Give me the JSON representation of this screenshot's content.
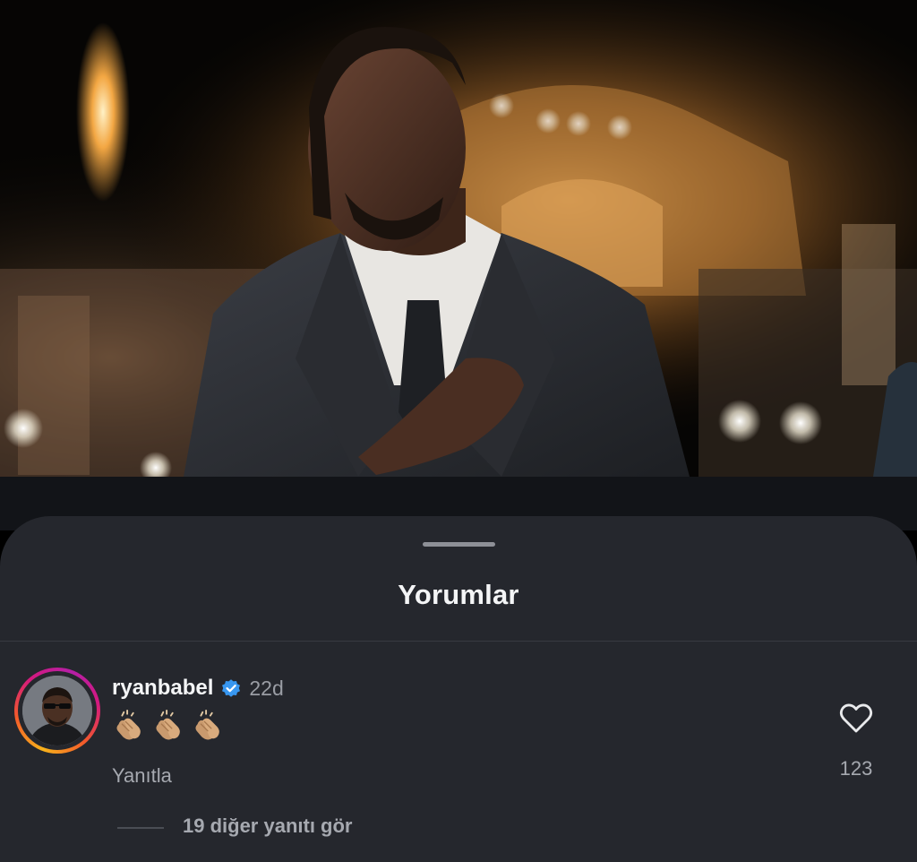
{
  "sheet": {
    "title": "Yorumlar"
  },
  "comment": {
    "username": "ryanbabel",
    "time": "22d",
    "verified": true,
    "text_emoji": [
      "clapping-hands",
      "clapping-hands",
      "clapping-hands"
    ],
    "reply_label": "Yanıtla",
    "like_count": "123",
    "view_replies_label": "19 diğer yanıtı gör"
  },
  "colors": {
    "sheet_background": "#25272d",
    "verified_badge": "#3897f0",
    "avatar_ring_start": "#f7b21b",
    "avatar_ring_end": "#b51fa7"
  },
  "icons": {
    "like": "heart-icon",
    "verified": "verified-badge-icon"
  }
}
